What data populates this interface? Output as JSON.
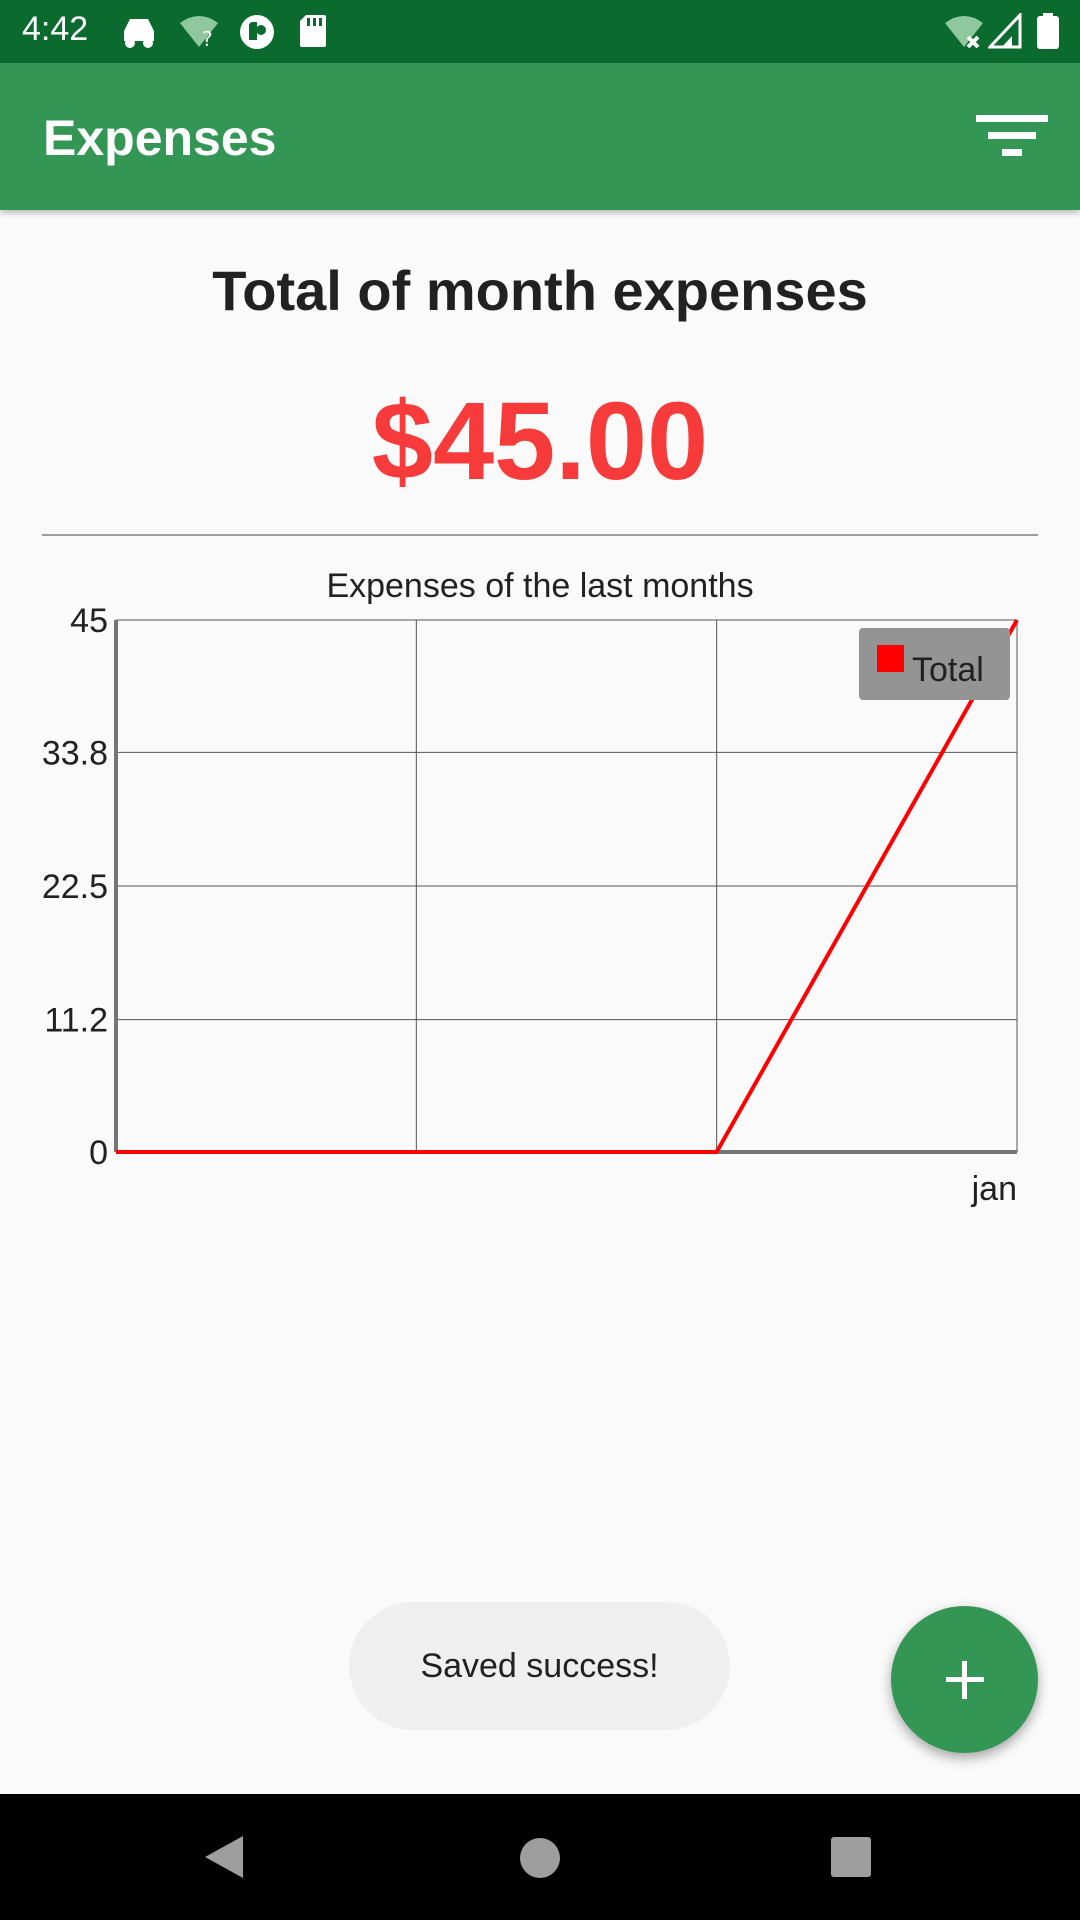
{
  "status_bar": {
    "time": "4:42",
    "left_icons": [
      "car-mode-icon",
      "wifi-question-icon",
      "pocket-casts-icon",
      "sd-card-icon"
    ],
    "right_icons": [
      "wifi-off-icon",
      "cell-signal-icon",
      "battery-icon"
    ],
    "background": "#0b6b2e"
  },
  "app_bar": {
    "title": "Expenses",
    "filter_icon": "filter-icon",
    "background": "#349654"
  },
  "summary": {
    "heading": "Total of month expenses",
    "amount": "$45.00",
    "amount_color": "#f73b3b"
  },
  "chart_data": {
    "type": "line",
    "title": "Expenses of the last months",
    "xlabel": "",
    "ylabel": "",
    "x": [
      "",
      "",
      "",
      "jan"
    ],
    "ylim": [
      0,
      45
    ],
    "y_ticks": [
      "0",
      "11.2",
      "22.5",
      "33.8",
      "45"
    ],
    "grid": true,
    "legend_position": "top-right",
    "series": [
      {
        "name": "Total",
        "color": "#ff0000",
        "values": [
          0,
          0,
          0,
          45
        ]
      }
    ]
  },
  "toast": {
    "text": "Saved success!"
  },
  "fab": {
    "icon": "plus-icon",
    "color": "#349654"
  },
  "nav_bar": {
    "icons": [
      "back-icon",
      "home-icon",
      "recents-icon"
    ]
  }
}
